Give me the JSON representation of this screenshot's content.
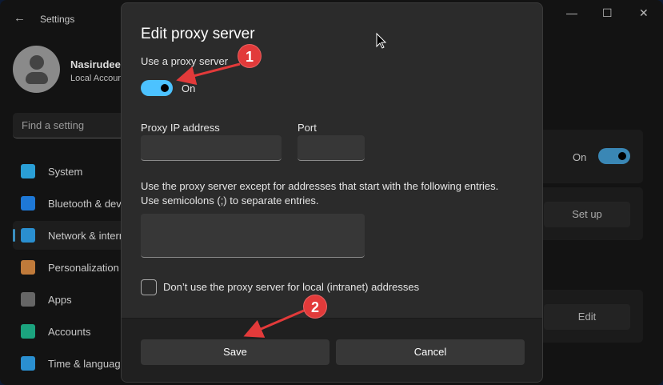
{
  "window": {
    "title": "Settings",
    "minimize": "—",
    "maximize": "☐",
    "close": "✕",
    "back": "←"
  },
  "user": {
    "name": "Nasirudeen",
    "type": "Local Account"
  },
  "search": {
    "placeholder": "Find a setting"
  },
  "sidebar": {
    "items": [
      {
        "label": "System",
        "icon": "system-icon",
        "color": "#2a9fd6"
      },
      {
        "label": "Bluetooth & devices",
        "icon": "bluetooth-icon",
        "color": "#1e78d6"
      },
      {
        "label": "Network & internet",
        "icon": "wifi-icon",
        "color": "#2a8fd0",
        "selected": true
      },
      {
        "label": "Personalization",
        "icon": "brush-icon",
        "color": "#c07a3a"
      },
      {
        "label": "Apps",
        "icon": "apps-icon",
        "color": "#666"
      },
      {
        "label": "Accounts",
        "icon": "accounts-icon",
        "color": "#1ba37e"
      },
      {
        "label": "Time & language",
        "icon": "globe-clock-icon",
        "color": "#2a8fd0"
      }
    ]
  },
  "background": {
    "toggle_label": "On",
    "setup_button": "Set up",
    "edit_button": "Edit"
  },
  "dialog": {
    "title": "Edit proxy server",
    "use_proxy_label": "Use a proxy server",
    "toggle_state": "On",
    "ip_label": "Proxy IP address",
    "ip_value": "",
    "port_label": "Port",
    "port_value": "",
    "exceptions_text1": "Use the proxy server except for addresses that start with the following entries.",
    "exceptions_text2": "Use semicolons (;) to separate entries.",
    "exceptions_value": "",
    "local_checkbox_label": "Don’t use the proxy server for local (intranet) addresses",
    "local_checked": false,
    "save": "Save",
    "cancel": "Cancel"
  },
  "annotations": [
    {
      "number": "1"
    },
    {
      "number": "2"
    }
  ]
}
